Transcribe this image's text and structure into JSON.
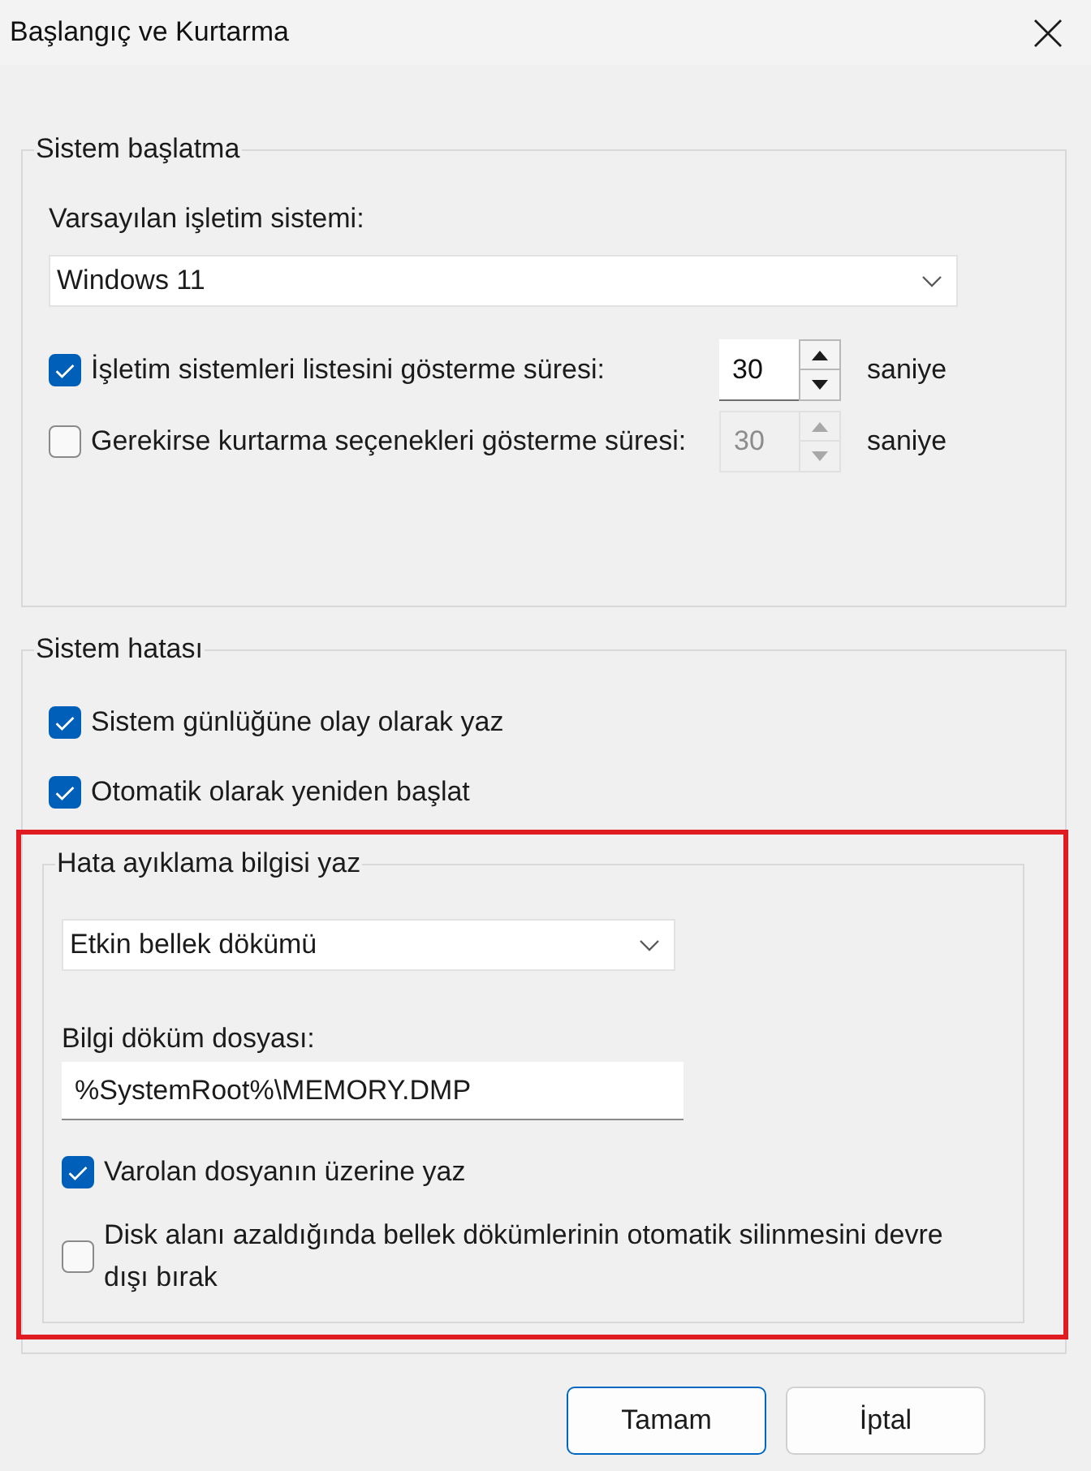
{
  "window": {
    "title": "Başlangıç ve Kurtarma"
  },
  "system_startup": {
    "title": "Sistem başlatma",
    "default_os_label": "Varsayılan işletim sistemi:",
    "default_os": "Windows 11",
    "timers": [
      {
        "label": "İşletim sistemleri listesini gösterme süresi:",
        "checked": true,
        "value": "30",
        "unit": "saniye",
        "disabled": false
      },
      {
        "label": "Gerekirse kurtarma seçenekleri gösterme süresi:",
        "checked": false,
        "value": "30",
        "unit": "saniye",
        "disabled": true
      }
    ]
  },
  "system_failure": {
    "title": "Sistem hatası",
    "options": [
      {
        "label": "Sistem günlüğüne olay olarak yaz",
        "checked": true
      },
      {
        "label": "Otomatik olarak yeniden başlat",
        "checked": true
      }
    ],
    "debug_info": {
      "title": "Hata ayıklama bilgisi yaz",
      "highlighted": true,
      "dump_type": "Etkin bellek dökümü",
      "dump_file_label": "Bilgi döküm dosyası:",
      "dump_file": "%SystemRoot%\\MEMORY.DMP",
      "options": [
        {
          "label": "Varolan dosyanın üzerine yaz",
          "checked": true
        },
        {
          "label": "Disk alanı azaldığında bellek dökümlerinin otomatik silinmesini devre dışı bırak",
          "checked": false
        }
      ]
    }
  },
  "buttons": [
    {
      "label": "Tamam",
      "default": true
    },
    {
      "label": "İptal",
      "default": false
    }
  ]
}
